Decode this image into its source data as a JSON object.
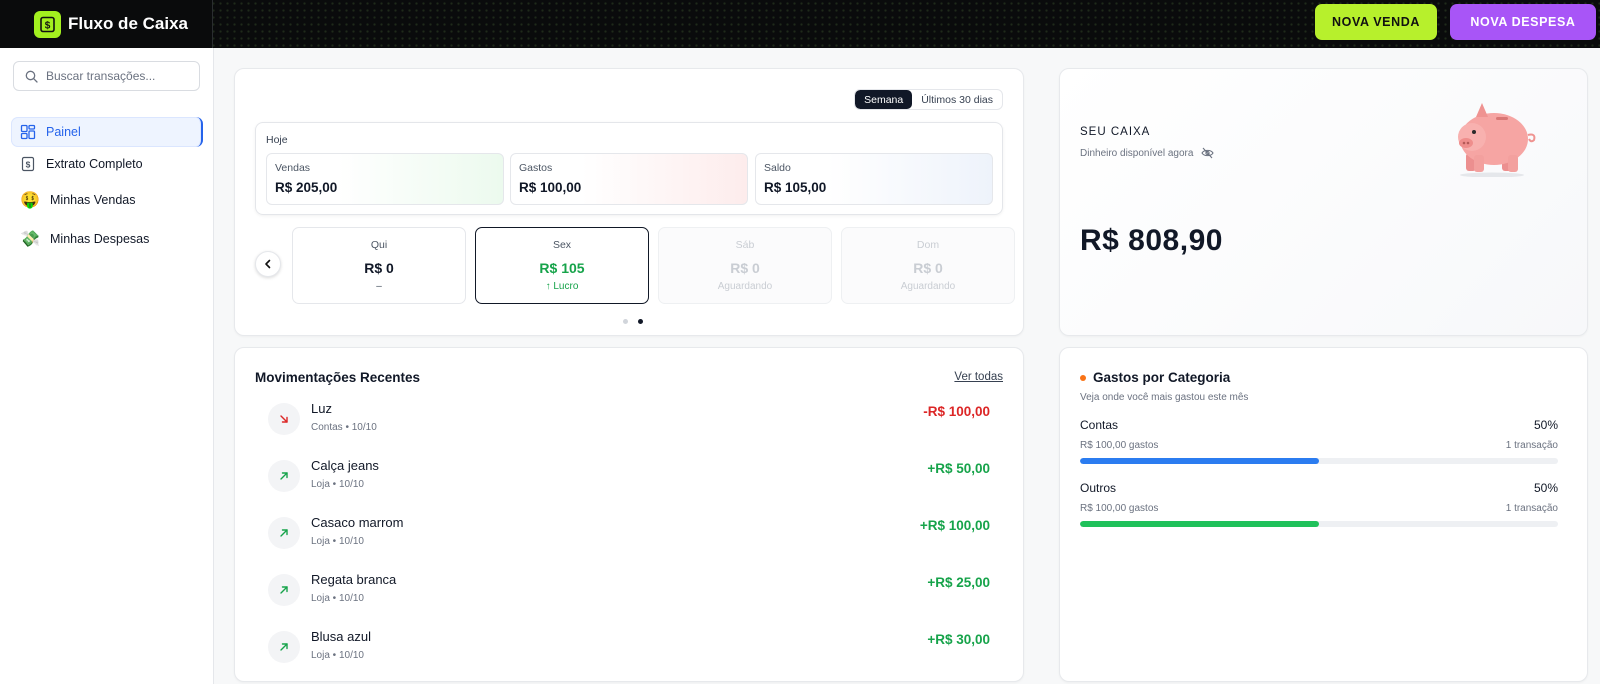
{
  "app": {
    "title": "Fluxo de Caixa"
  },
  "header": {
    "nova_venda": "NOVA VENDA",
    "nova_despesa": "NOVA DESPESA"
  },
  "sidebar": {
    "search_placeholder": "Buscar transações...",
    "items": [
      {
        "label": "Painel",
        "icon": "dashboard-icon",
        "active": true
      },
      {
        "label": "Extrato Completo",
        "icon": "dollar-document-icon"
      },
      {
        "label": "Minhas Vendas",
        "icon": "money-face-emoji"
      },
      {
        "label": "Minhas Despesas",
        "icon": "flying-money-emoji"
      }
    ]
  },
  "overview": {
    "toggle": {
      "semana": "Semana",
      "ultimos": "Últimos 30 dias",
      "selected": "Semana"
    },
    "hoje_label": "Hoje",
    "stats": [
      {
        "label": "Vendas",
        "value": "R$ 205,00"
      },
      {
        "label": "Gastos",
        "value": "R$ 100,00"
      },
      {
        "label": "Saldo",
        "value": "R$ 105,00"
      }
    ],
    "days": [
      {
        "name": "Qui",
        "value": "R$ 0",
        "status": "–"
      },
      {
        "name": "Sex",
        "value": "R$ 105",
        "status": "↑ Lucro"
      },
      {
        "name": "Sáb",
        "value": "R$ 0",
        "status": "Aguardando"
      },
      {
        "name": "Dom",
        "value": "R$ 0",
        "status": "Aguardando"
      }
    ],
    "pagination": {
      "pages": 2,
      "current": 2
    }
  },
  "caixa": {
    "title": "SEU CAIXA",
    "subtitle": "Dinheiro disponível agora",
    "value": "R$ 808,90"
  },
  "movimentacoes": {
    "title": "Movimentações Recentes",
    "ver_todas": "Ver todas",
    "items": [
      {
        "name": "Luz",
        "meta": "Contas • 10/10",
        "amount": "-R$ 100,00",
        "type": "out"
      },
      {
        "name": "Calça jeans",
        "meta": "Loja • 10/10",
        "amount": "+R$ 50,00",
        "type": "in"
      },
      {
        "name": "Casaco marrom",
        "meta": "Loja • 10/10",
        "amount": "+R$ 100,00",
        "type": "in"
      },
      {
        "name": "Regata branca",
        "meta": "Loja • 10/10",
        "amount": "+R$ 25,00",
        "type": "in"
      },
      {
        "name": "Blusa azul",
        "meta": "Loja • 10/10",
        "amount": "+R$ 30,00",
        "type": "in"
      }
    ]
  },
  "categorias": {
    "title": "Gastos por Categoria",
    "subtitle": "Veja onde você mais gastou este mês",
    "items": [
      {
        "name": "Contas",
        "percent": "50%",
        "gastos": "R$ 100,00 gastos",
        "transacoes": "1 transação",
        "fraction": 0.5,
        "color": "#2b7cf0"
      },
      {
        "name": "Outros",
        "percent": "50%",
        "gastos": "R$ 100,00 gastos",
        "transacoes": "1 transação",
        "fraction": 0.5,
        "color": "#1fc15a"
      }
    ]
  },
  "colors": {
    "accent_lime": "#b7f02c",
    "accent_purple": "#a855f7",
    "positive": "#16a34a",
    "negative": "#dc2626",
    "category_bullet": "#f97316"
  }
}
